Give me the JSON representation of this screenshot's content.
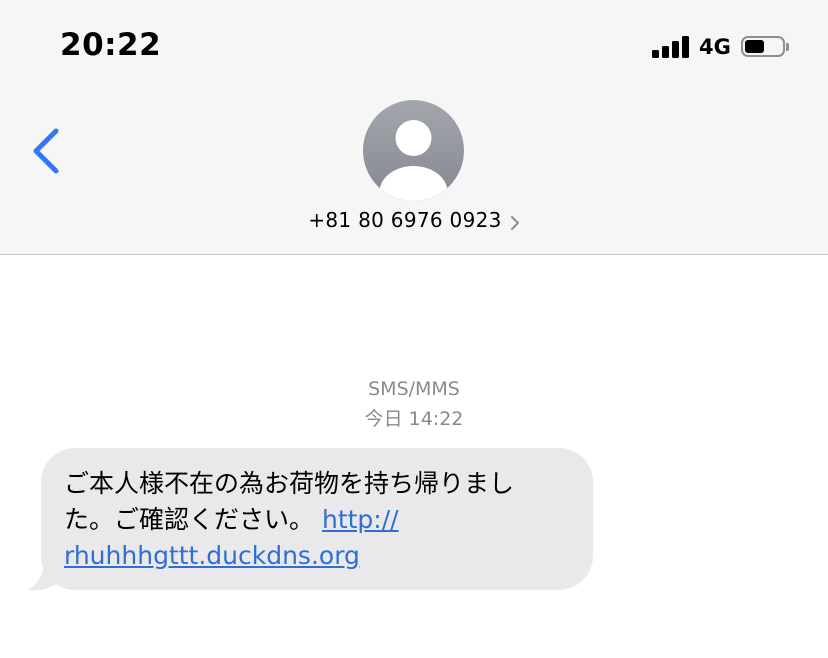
{
  "status_bar": {
    "time": "20:22",
    "network": "4G",
    "signal_bars": 4,
    "battery_level": 0.5
  },
  "header": {
    "contact": "+81 80 6976 0923",
    "back_icon": "chevron-left-icon",
    "avatar_icon": "person-silhouette-icon",
    "accent_color": "#3478f6"
  },
  "thread": {
    "service": "SMS/MMS",
    "date": "今日 14:22",
    "message": {
      "line1": "ご本人様不在の為お荷物を持ち帰りまし",
      "line2_text": "た。ご確認ください。",
      "link_part1": "http://",
      "link_part2": "rhuhhhgttt.duckdns.org"
    }
  },
  "colors": {
    "header_bg": "#f6f6f6",
    "bubble_bg": "#e9e9eb",
    "link": "#2f6fd3",
    "meta_text": "#8a8a8e"
  }
}
